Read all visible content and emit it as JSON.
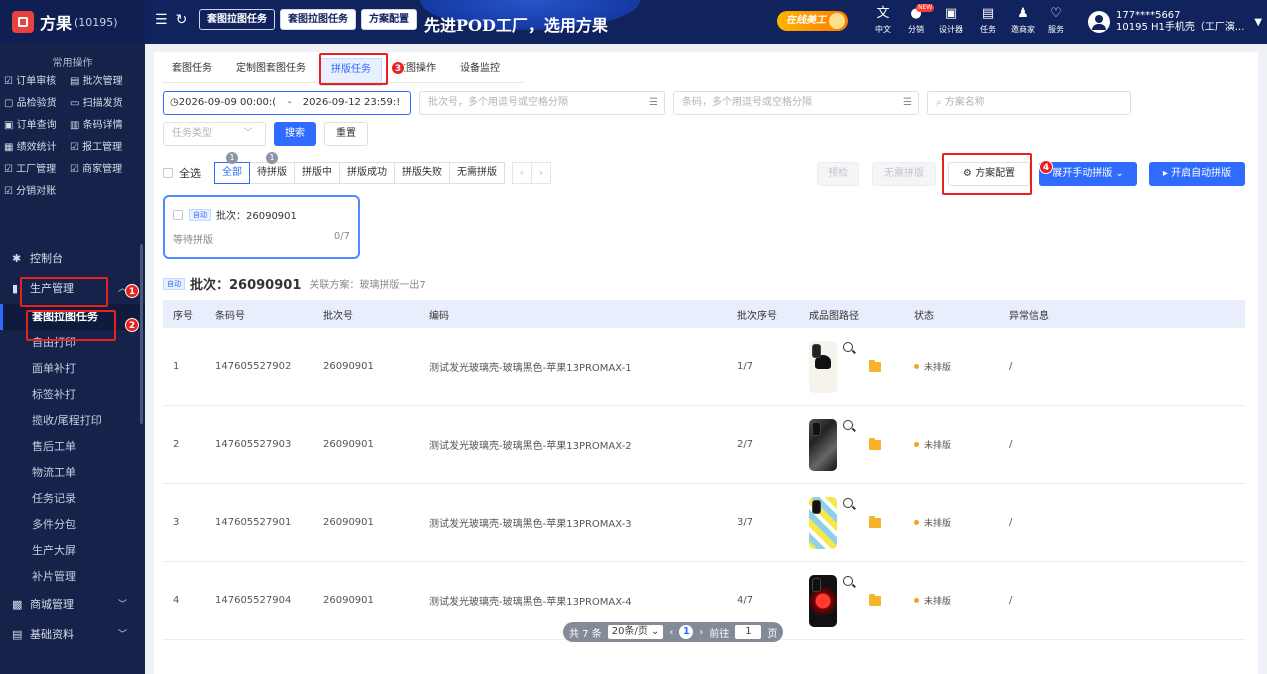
{
  "app": {
    "name": "方果",
    "code": "(10195)"
  },
  "top_tabs": [
    {
      "label": "套图拉图任务",
      "active": false
    },
    {
      "label": "套图拉图任务",
      "active": true
    },
    {
      "label": "方案配置",
      "active": false
    }
  ],
  "banner": {
    "text": "先进POD工厂，选用方果"
  },
  "online_label": "在线美工",
  "utils": [
    {
      "label": "中文",
      "icon": "translate-icon"
    },
    {
      "label": "分销",
      "icon": "distribution-icon",
      "badge": "NEW"
    },
    {
      "label": "设计器",
      "icon": "designer-icon"
    },
    {
      "label": "任务",
      "icon": "task-icon"
    },
    {
      "label": "邀商家",
      "icon": "invite-icon"
    },
    {
      "label": "服务",
      "icon": "service-icon"
    }
  ],
  "user": {
    "phone": "177****5667",
    "org": "10195 H1手机壳（工厂演..."
  },
  "sidebar": {
    "quick_title": "常用操作",
    "quick": [
      "订单审核",
      "批次管理",
      "品检验货",
      "扫描发货",
      "订单查询",
      "条码详情",
      "绩效统计",
      "报工管理",
      "工厂管理",
      "商家管理",
      "分销对账"
    ],
    "nav": {
      "console": "控制台",
      "production": "生产管理",
      "sub": [
        "套图拉图任务",
        "自由打印",
        "面单补打",
        "标签补打",
        "揽收/尾程打印",
        "售后工单",
        "物流工单",
        "任务记录",
        "多件分包",
        "生产大屏",
        "补片管理"
      ],
      "mall": "商城管理",
      "basic": "基础资料"
    }
  },
  "tabs": [
    "套图任务",
    "定制图套图任务",
    "拼版任务",
    "拉图操作",
    "设备监控"
  ],
  "filters": {
    "date_start": "2026-09-09 00:00:(",
    "date_sep": "-",
    "date_end": "2026-09-12 23:59:!",
    "batch_placeholder": "批次号，多个用逗号或空格分隔",
    "barcode_placeholder": "条码，多个用逗号或空格分隔",
    "scheme_placeholder": "方案名称",
    "task_type_placeholder": "任务类型",
    "search_label": "搜索",
    "reset_label": "重置"
  },
  "toolbar": {
    "select_all": "全选",
    "segments": [
      {
        "label": "全部",
        "badge": "1",
        "active": true
      },
      {
        "label": "待拼版",
        "badge": "1",
        "active": false
      },
      {
        "label": "拼版中",
        "badge": "",
        "active": false
      },
      {
        "label": "拼版成功",
        "badge": "",
        "active": false
      },
      {
        "label": "拼版失败",
        "badge": "",
        "active": false
      },
      {
        "label": "无需拼版",
        "badge": "",
        "active": false
      }
    ],
    "preview_label": "预检",
    "no_need_label": "无需拼版",
    "scheme_config_label": "方案配置",
    "manual_label": "展开手动拼版",
    "auto_label": "开启自动拼版"
  },
  "batch_card": {
    "tag": "自动",
    "title": "批次：26090901",
    "status": "等待拼版",
    "progress": "0/7"
  },
  "batch_header": {
    "tag": "自动",
    "title": "批次：26090901",
    "assoc": "关联方案：玻璃拼版一出7"
  },
  "table": {
    "columns": [
      "序号",
      "条码号",
      "批次号",
      "编码",
      "批次序号",
      "成品图路径",
      "状态",
      "异常信息"
    ],
    "rows": [
      {
        "idx": "1",
        "barcode": "147605527902",
        "batch": "26090901",
        "code": "测试发光玻璃壳-玻璃黑色-苹果13PROMAX-1",
        "seq": "1/7",
        "status": "未排版",
        "error": "/"
      },
      {
        "idx": "2",
        "barcode": "147605527903",
        "batch": "26090901",
        "code": "测试发光玻璃壳-玻璃黑色-苹果13PROMAX-2",
        "seq": "2/7",
        "status": "未排版",
        "error": "/"
      },
      {
        "idx": "3",
        "barcode": "147605527901",
        "batch": "26090901",
        "code": "测试发光玻璃壳-玻璃黑色-苹果13PROMAX-3",
        "seq": "3/7",
        "status": "未排版",
        "error": "/"
      },
      {
        "idx": "4",
        "barcode": "147605527904",
        "batch": "26090901",
        "code": "测试发光玻璃壳-玻璃黑色-苹果13PROMAX-4",
        "seq": "4/7",
        "status": "未排版",
        "error": "/"
      }
    ]
  },
  "pager": {
    "total": "共 7 条",
    "page_size": "20条/页",
    "current": "1",
    "goto": "前往",
    "goto_value": "1",
    "page_unit": "页"
  },
  "annotations": [
    "1",
    "2",
    "3",
    "4"
  ],
  "colors": {
    "accent": "#2f6bff",
    "annotation": "#e8201e",
    "sidebar": "#16224a",
    "topbar": "#11235c"
  }
}
